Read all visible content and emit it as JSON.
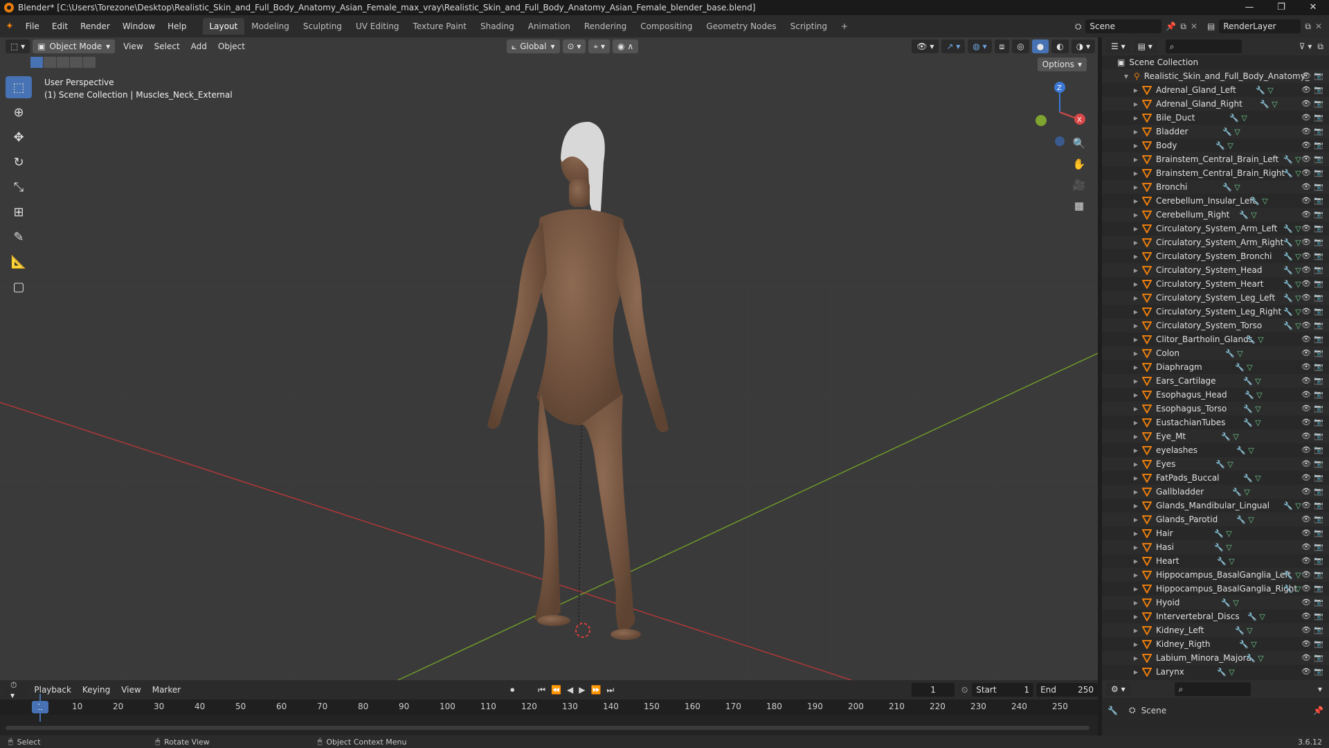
{
  "window": {
    "title": "Blender* [C:\\Users\\Torezone\\Desktop\\Realistic_Skin_and_Full_Body_Anatomy_Asian_Female_max_vray\\Realistic_Skin_and_Full_Body_Anatomy_Asian_Female_blender_base.blend]",
    "min": "—",
    "max": "❐",
    "close": "✕"
  },
  "menu": [
    "File",
    "Edit",
    "Render",
    "Window",
    "Help"
  ],
  "workspaces": [
    "Layout",
    "Modeling",
    "Sculpting",
    "UV Editing",
    "Texture Paint",
    "Shading",
    "Animation",
    "Rendering",
    "Compositing",
    "Geometry Nodes",
    "Scripting"
  ],
  "add_tab": "+",
  "scene": {
    "name": "Scene",
    "render_layer": "RenderLayer"
  },
  "viewport": {
    "mode": "Object Mode",
    "menus": [
      "View",
      "Select",
      "Add",
      "Object"
    ],
    "transform": "Global",
    "options": "Options",
    "info_line1": "User Perspective",
    "info_line2": "(1) Scene Collection | Muscles_Neck_External",
    "axis_x": "X",
    "axis_y": "Y",
    "axis_z": "Z"
  },
  "outliner": {
    "root": "Scene Collection",
    "collection": "Realistic_Skin_and_Full_Body_Anatomy_",
    "items": [
      "Adrenal_Gland_Left",
      "Adrenal_Gland_Right",
      "Bile_Duct",
      "Bladder",
      "Body",
      "Brainstem_Central_Brain_Left",
      "Brainstem_Central_Brain_Right",
      "Bronchi",
      "Cerebellum_Insular_Left",
      "Cerebellum_Right",
      "Circulatory_System_Arm_Left",
      "Circulatory_System_Arm_Right",
      "Circulatory_System_Bronchi",
      "Circulatory_System_Head",
      "Circulatory_System_Heart",
      "Circulatory_System_Leg_Left",
      "Circulatory_System_Leg_Right",
      "Circulatory_System_Torso",
      "Clitor_Bartholin_Glands",
      "Colon",
      "Diaphragm",
      "Ears_Cartilage",
      "Esophagus_Head",
      "Esophagus_Torso",
      "EustachianTubes",
      "Eye_Mt",
      "eyelashes",
      "Eyes",
      "FatPads_Buccal",
      "Gallbladder",
      "Glands_Mandibular_Lingual",
      "Glands_Parotid",
      "Hair",
      "Hasi",
      "Heart",
      "Hippocampus_BasalGanglia_Left",
      "Hippocampus_BasalGanglia_Right",
      "Hyoid",
      "Intervertebral_Discs",
      "Kidney_Left",
      "Kidney_Rigth",
      "Labium_Minora_Majora",
      "Larynx"
    ]
  },
  "timeline": {
    "menus": [
      "Playback",
      "Keying",
      "View",
      "Marker"
    ],
    "current_frame": "1",
    "start_label": "Start",
    "start": "1",
    "end_label": "End",
    "end": "250",
    "ticks": [
      "10",
      "20",
      "30",
      "40",
      "50",
      "60",
      "70",
      "80",
      "90",
      "100",
      "110",
      "120",
      "130",
      "140",
      "150",
      "160",
      "170",
      "180",
      "190",
      "200",
      "210",
      "220",
      "230",
      "240",
      "250"
    ]
  },
  "properties": {
    "scene_label": "Scene"
  },
  "status": {
    "select": "Select",
    "rotate": "Rotate View",
    "context": "Object Context Menu",
    "version": "3.6.12"
  },
  "colors": {
    "accent": "#4772b3",
    "viewport_bg": "#3a3a3a",
    "skin": "#7a5a44",
    "x_axis": "#c0393a",
    "y_axis": "#7fa430",
    "orange": "#e87d0d"
  }
}
